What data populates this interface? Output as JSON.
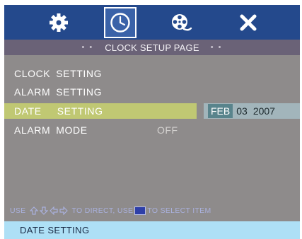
{
  "icon_bar": {
    "tabs": [
      {
        "icon": "gear-icon",
        "selected": false
      },
      {
        "icon": "clock-icon",
        "selected": true
      },
      {
        "icon": "film-reel-icon",
        "selected": false
      },
      {
        "icon": "close-icon",
        "selected": false
      }
    ]
  },
  "title_bar": {
    "left_dots": "• •",
    "title": "CLOCK SETUP PAGE",
    "right_dots": "• •"
  },
  "menu": {
    "items": [
      {
        "word1": "CLOCK",
        "word2": "SETTING",
        "selected": false
      },
      {
        "word1": "ALARM",
        "word2": "SETTING",
        "selected": false
      },
      {
        "word1": "DATE",
        "word2": "SETTING",
        "selected": true
      },
      {
        "word1": "ALARM",
        "word2": "MODE",
        "selected": false,
        "value": "OFF"
      }
    ]
  },
  "date_field": {
    "month": "FEB",
    "day": "03",
    "year": "2007"
  },
  "hint": {
    "use_label": "USE",
    "direct_label": "TO DIRECT, USE",
    "select_label": "TO SELECT ITEM"
  },
  "status_bar": {
    "text": "DATE SETTING"
  },
  "colors": {
    "icon_bar": "#24498c",
    "title_bar": "#6a6277",
    "screen": "#8e8b8b",
    "highlight": "#c0c873",
    "date_box": "#a2b5bb",
    "month_highlight": "#59848c",
    "status_bar": "#aee0f6"
  }
}
